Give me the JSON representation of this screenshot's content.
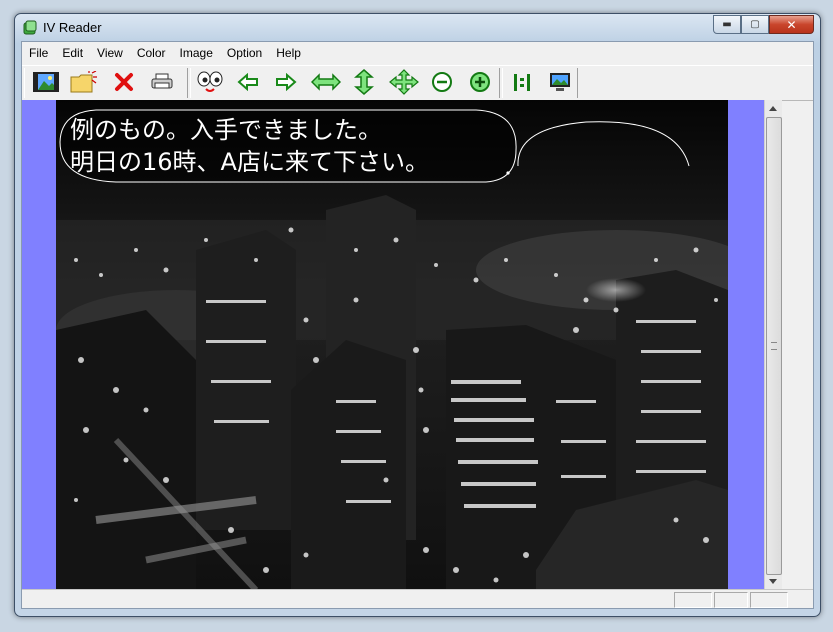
{
  "window": {
    "title": "IV Reader"
  },
  "menu": [
    "File",
    "Edit",
    "View",
    "Color",
    "Image",
    "Option",
    "Help"
  ],
  "toolbar_icons": [
    "open-image-icon",
    "open-folder-icon",
    "close-x-icon",
    "print-icon",
    "eyes-icon",
    "arrow-left-icon",
    "arrow-right-icon",
    "fit-width-icon",
    "fit-height-icon",
    "fit-both-icon",
    "zoom-out-icon",
    "zoom-in-icon",
    "actual-size-icon",
    "screen-icon"
  ],
  "image": {
    "caption_line1": "例のもの。入手できました。",
    "caption_line2": "明日の16時、A店に来て下さい。"
  },
  "colors": {
    "viewport_bg": "#8080ff",
    "caption_text": "#ffffff"
  }
}
